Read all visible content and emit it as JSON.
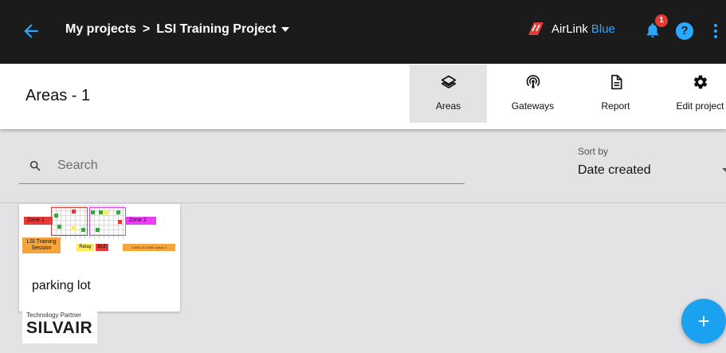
{
  "header": {
    "root_crumb": "My projects",
    "separator": ">",
    "project_name": "LSI Training Project",
    "brand_primary": "AirLink",
    "brand_secondary": "Blue",
    "notification_count": "1",
    "help_label": "?"
  },
  "toolbar": {
    "page_title": "Areas - 1",
    "tabs": [
      {
        "label": "Areas",
        "icon": "layers-icon",
        "active": true
      },
      {
        "label": "Gateways",
        "icon": "gateway-signal-icon",
        "active": false
      },
      {
        "label": "Report",
        "icon": "report-document-icon",
        "active": false
      },
      {
        "label": "Edit project",
        "icon": "gear-icon",
        "active": false
      }
    ]
  },
  "search": {
    "placeholder": "Search",
    "value": ""
  },
  "sort": {
    "label": "Sort by",
    "value": "Date created"
  },
  "areas": [
    {
      "name": "parking lot",
      "thumbnail": {
        "zone1": "Zone 1",
        "zone2": "Zone 2",
        "session": "LSI Training Session",
        "relay": "Relay",
        "ble": "BLE",
        "phone": "1-800-LSI-7366 Option 4"
      }
    }
  ],
  "partner": {
    "caption": "Technology Partner",
    "name": "SILVAIR"
  },
  "fab": {
    "label": "+"
  },
  "colors": {
    "topbar": "#1b1b1b",
    "accent": "#2ba8ff",
    "fab": "#1aa2f0",
    "badge": "#e53935",
    "background": "#e3e3e5"
  }
}
